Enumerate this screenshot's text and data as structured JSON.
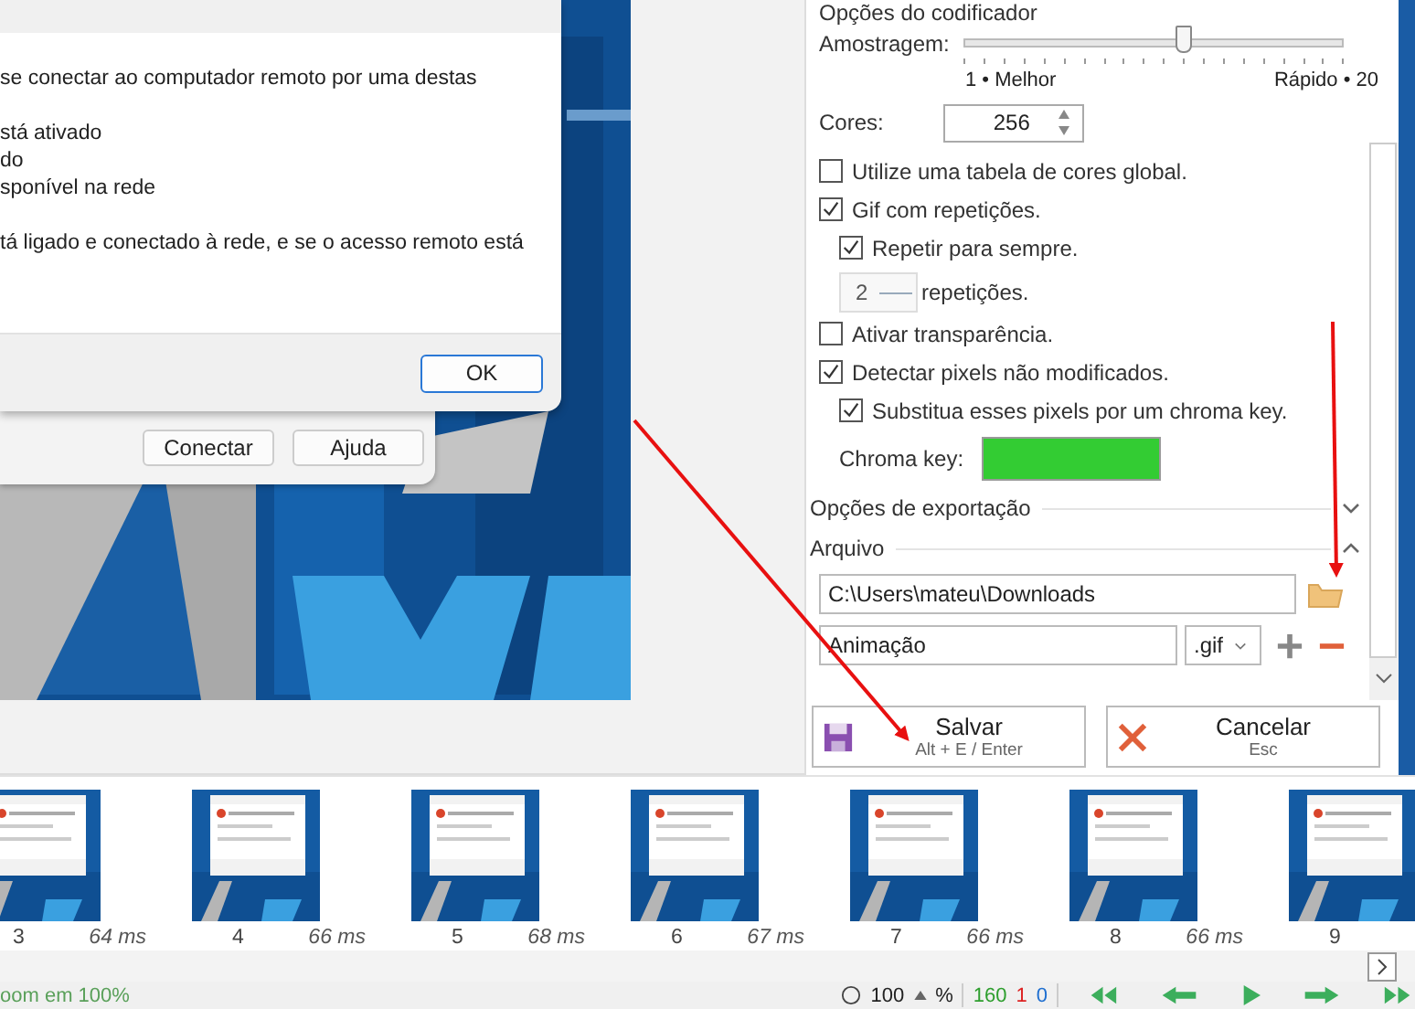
{
  "preview": {
    "back_window": {
      "buttons": [
        "Conectar",
        "Ajuda"
      ]
    },
    "dialog": {
      "paragraphs": [
        [
          "se conectar ao computador remoto por uma destas"
        ],
        [
          "stá ativado",
          "do",
          "sponível na rede"
        ],
        [
          "tá ligado e conectado à rede, e se o acesso remoto está"
        ]
      ],
      "ok_button": "OK"
    }
  },
  "encoder": {
    "title": "Opções do codificador",
    "sampling": {
      "label": "Amostragem:",
      "level": 0.58,
      "min_label": "1 • Melhor",
      "max_label": "Rápido • 20"
    },
    "colors": {
      "label": "Cores:",
      "value": "256"
    },
    "options": [
      {
        "kind": "checkbox",
        "label": "Utilize uma tabela de cores global.",
        "checked": false
      },
      {
        "kind": "checkbox",
        "label": "Gif com repetições.",
        "checked": true,
        "children": [
          {
            "kind": "checkbox",
            "label": "Repetir para sempre.",
            "checked": true
          },
          {
            "kind": "number",
            "value": "2",
            "label": "repetições."
          }
        ]
      },
      {
        "kind": "checkbox",
        "label": "Ativar transparência.",
        "checked": false
      },
      {
        "kind": "checkbox",
        "label": "Detectar pixels não modificados.",
        "checked": true,
        "children": [
          {
            "kind": "checkbox",
            "label": "Substitua esses pixels por um chroma key.",
            "checked": true
          },
          {
            "kind": "color",
            "label": "Chroma key:",
            "color": "#33cc33"
          }
        ]
      }
    ]
  },
  "export_section": {
    "title": "Opções de exportação",
    "expanded": false
  },
  "file_section": {
    "title": "Arquivo",
    "expanded": true,
    "folder": "C:\\Users\\mateu\\Downloads",
    "filename": "Animação",
    "extension": ".gif"
  },
  "actions": [
    {
      "kind": "save",
      "label": "Salvar",
      "shortcut": "Alt + E / Enter"
    },
    {
      "kind": "cancel",
      "label": "Cancelar",
      "shortcut": "Esc"
    }
  ],
  "frames": [
    {
      "number": "3",
      "delay": "64 ms"
    },
    {
      "number": "4",
      "delay": "66 ms"
    },
    {
      "number": "5",
      "delay": "68 ms"
    },
    {
      "number": "6",
      "delay": "67 ms"
    },
    {
      "number": "7",
      "delay": "66 ms"
    },
    {
      "number": "8",
      "delay": "66 ms"
    },
    {
      "number": "9"
    }
  ],
  "status_bar": {
    "message": "oom em 100%",
    "zoom": "100",
    "unit": "%",
    "total_frames": "160",
    "selected_frames": "1",
    "third_count": "0"
  }
}
